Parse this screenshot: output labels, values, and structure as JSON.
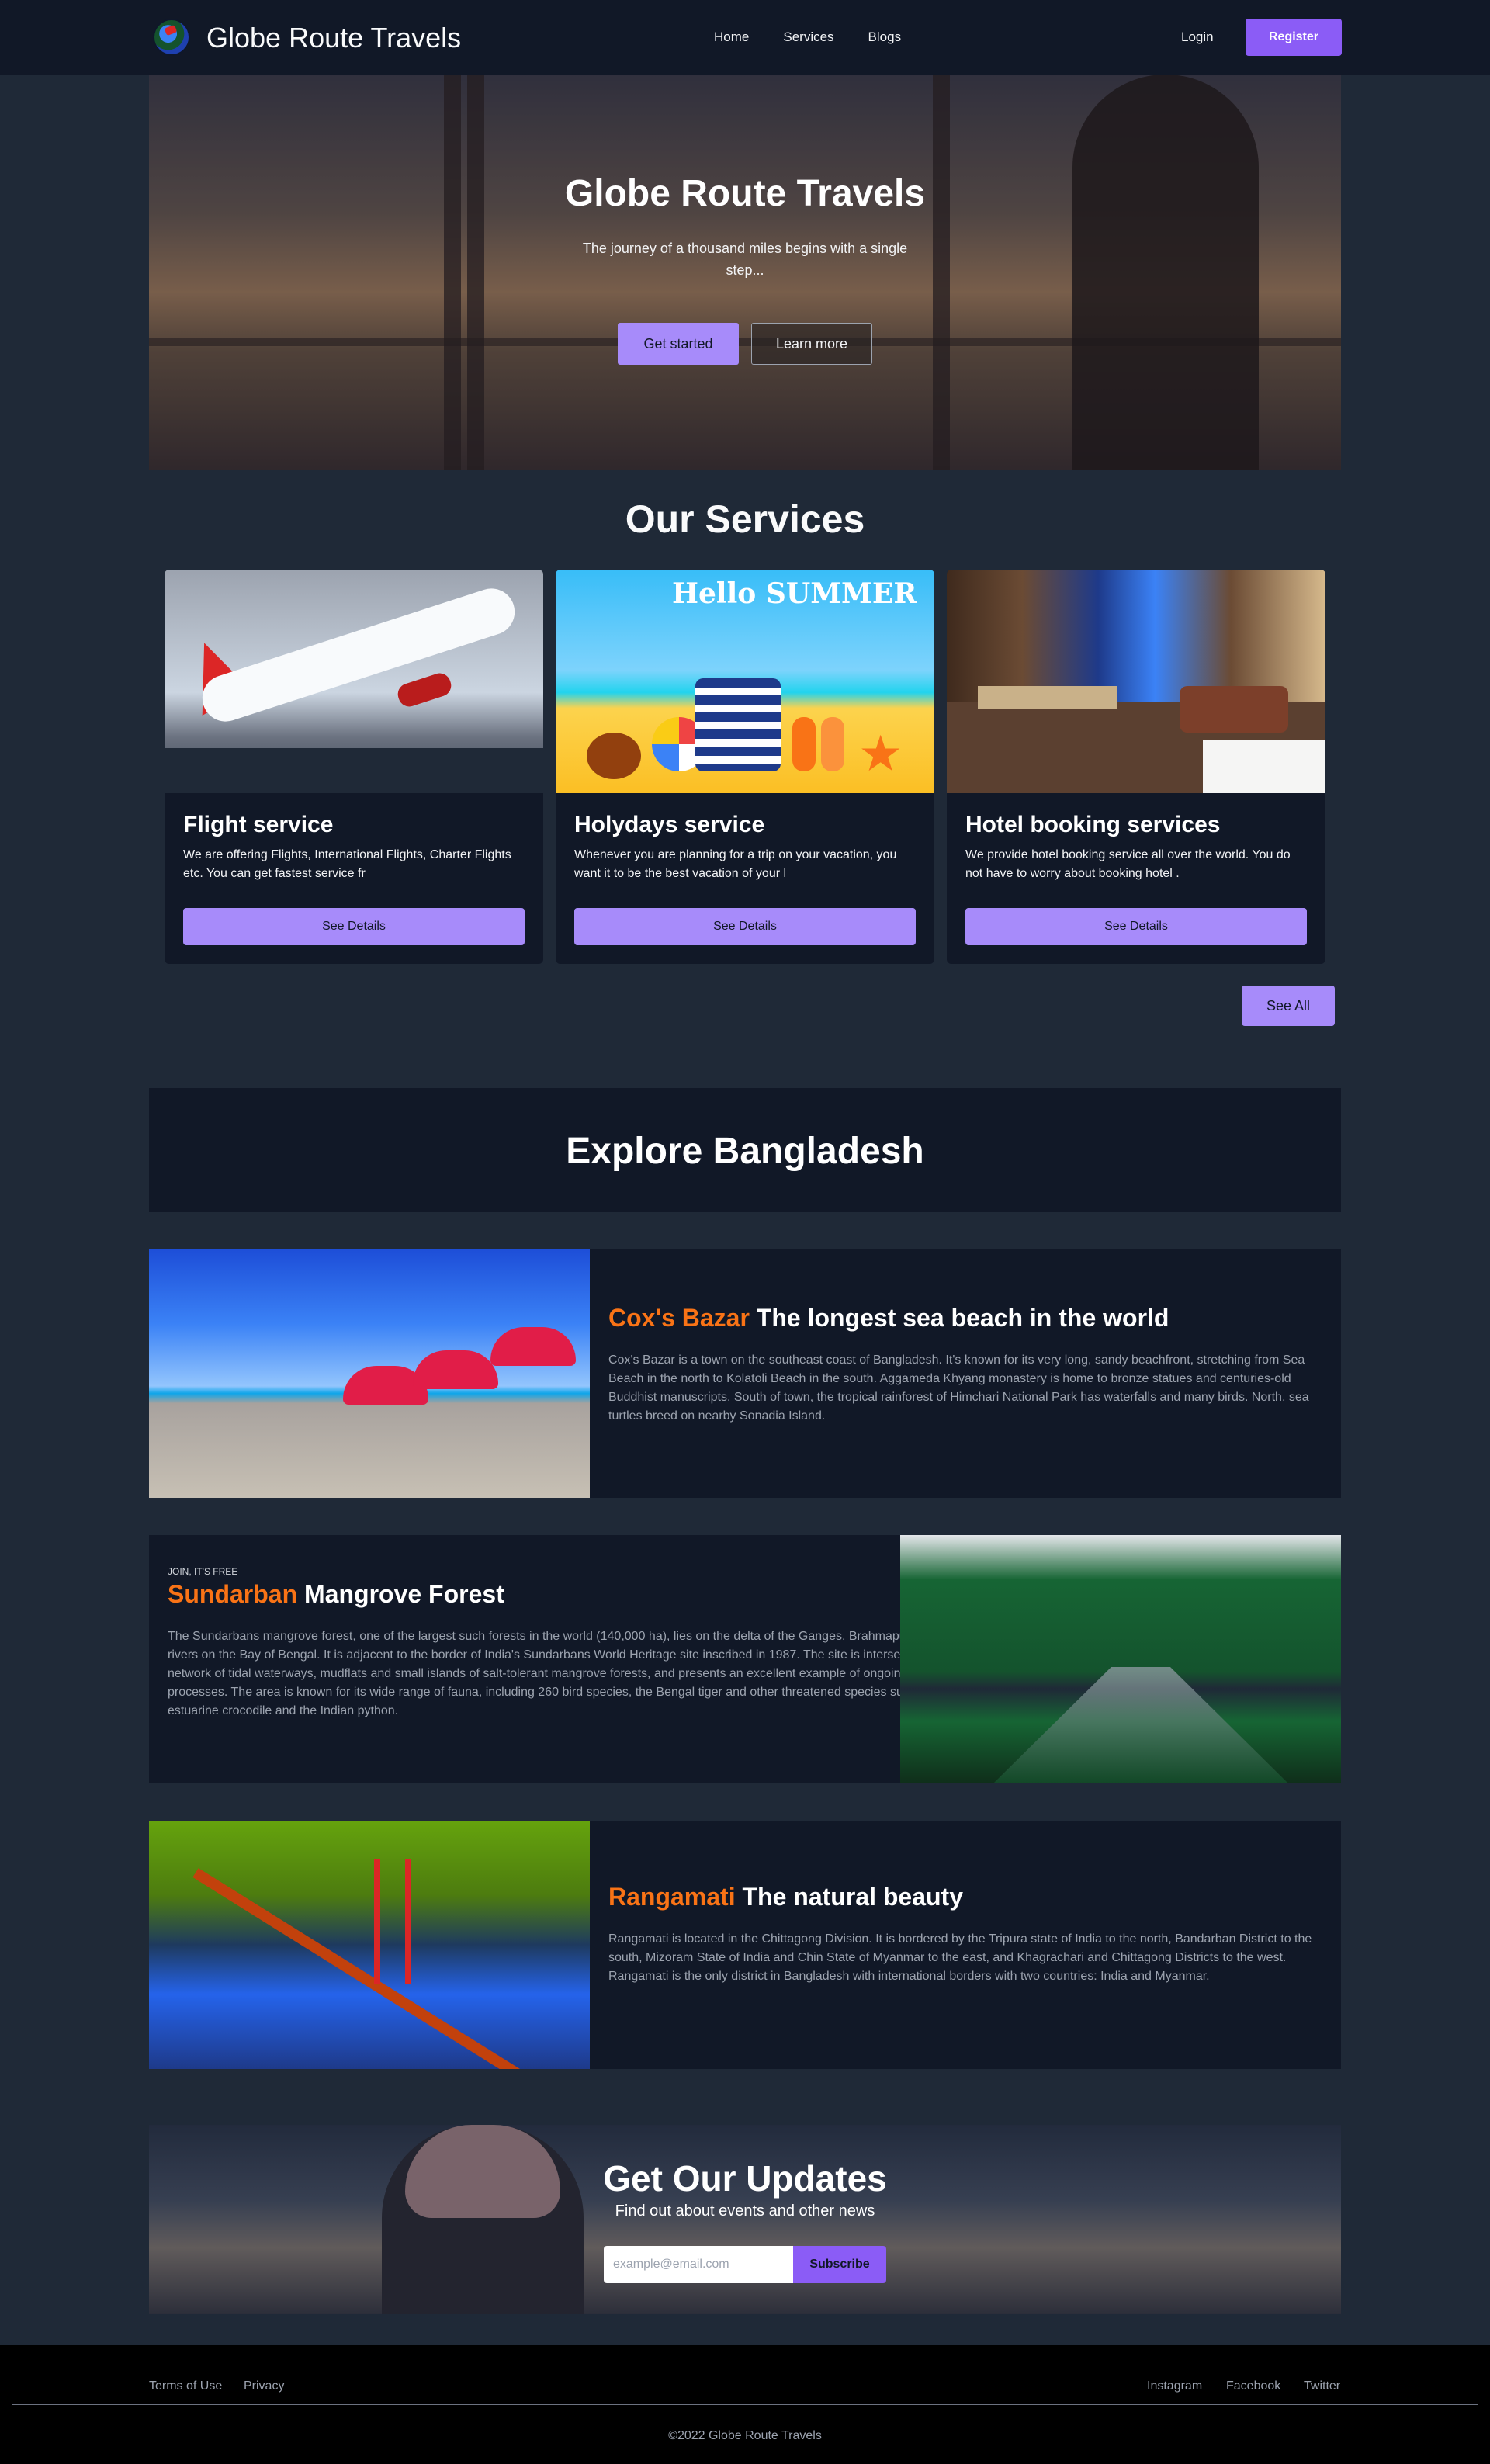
{
  "nav": {
    "brand": "Globe Route Travels",
    "links": [
      "Home",
      "Services",
      "Blogs"
    ],
    "login": "Login",
    "register": "Register"
  },
  "hero": {
    "title": "Globe Route Travels",
    "subtitle": "The journey of a thousand miles begins with a single step...",
    "primary_button": "Get started",
    "secondary_button": "Learn more"
  },
  "services": {
    "title": "Our Services",
    "cards": [
      {
        "title": "Flight service",
        "text": "We are offering Flights, International Flights, Charter Flights etc. You can get fastest service fr",
        "button": "See Details",
        "image": "airplane-takeoff"
      },
      {
        "title": "Holydays service",
        "text": "Whenever you are planning for a trip on your vacation, you want it to be the best vacation of your l",
        "button": "See Details",
        "image": "hello-summer-beach",
        "image_text": "Hello SUMMER"
      },
      {
        "title": "Hotel booking services",
        "text": "We provide hotel booking service all over the world. You do not have to worry about booking hotel .",
        "button": "See Details",
        "image": "hotel-room"
      }
    ],
    "see_all": "See All"
  },
  "explore": {
    "title": "Explore Bangladesh",
    "items": [
      {
        "highlight": "Cox's Bazar",
        "title": " The longest sea beach in the world",
        "kicker": "",
        "text": "Cox's Bazar is a town on the southeast coast of Bangladesh. It's known for its very long, sandy beachfront, stretching from Sea Beach in the north to Kolatoli Beach in the south. Aggameda Khyang monastery is home to bronze statues and centuries-old Buddhist manuscripts. South of town, the tropical rainforest of Himchari National Park has waterfalls and many birds. North, sea turtles breed on nearby Sonadia Island."
      },
      {
        "highlight": "Sundarban",
        "title": " Mangrove Forest",
        "kicker": "JOIN, IT'S FREE",
        "text": "The Sundarbans mangrove forest, one of the largest such forests in the world (140,000 ha), lies on the delta of the Ganges, Brahmaputra and Meghna rivers on the Bay of Bengal. It is adjacent to the border of India's Sundarbans World Heritage site inscribed in 1987. The site is intersected by a complex network of tidal waterways, mudflats and small islands of salt-tolerant mangrove forests, and presents an excellent example of ongoing ecological processes. The area is known for its wide range of fauna, including 260 bird species, the Bengal tiger and other threatened species such as the estuarine crocodile and the Indian python."
      },
      {
        "highlight": "Rangamati",
        "title": " The natural beauty",
        "kicker": "",
        "text": "Rangamati is located in the Chittagong Division. It is bordered by the Tripura state of India to the north, Bandarban District to the south, Mizoram State of India and Chin State of Myanmar to the east, and Khagrachari and Chittagong Districts to the west. Rangamati is the only district in Bangladesh with international borders with two countries: India and Myanmar."
      }
    ]
  },
  "updates": {
    "title": "Get Our Updates",
    "subtitle": "Find out about events and other news",
    "email_placeholder": "example@email.com",
    "subscribe": "Subscribe"
  },
  "footer": {
    "left_links": [
      "Terms of Use",
      "Privacy"
    ],
    "right_links": [
      "Instagram",
      "Facebook",
      "Twitter"
    ],
    "copyright": "©2022 Globe Route Travels"
  },
  "colors": {
    "accent": "#a78bfa",
    "highlight": "#f97316",
    "background": "#1f2937",
    "panel": "#111827"
  }
}
